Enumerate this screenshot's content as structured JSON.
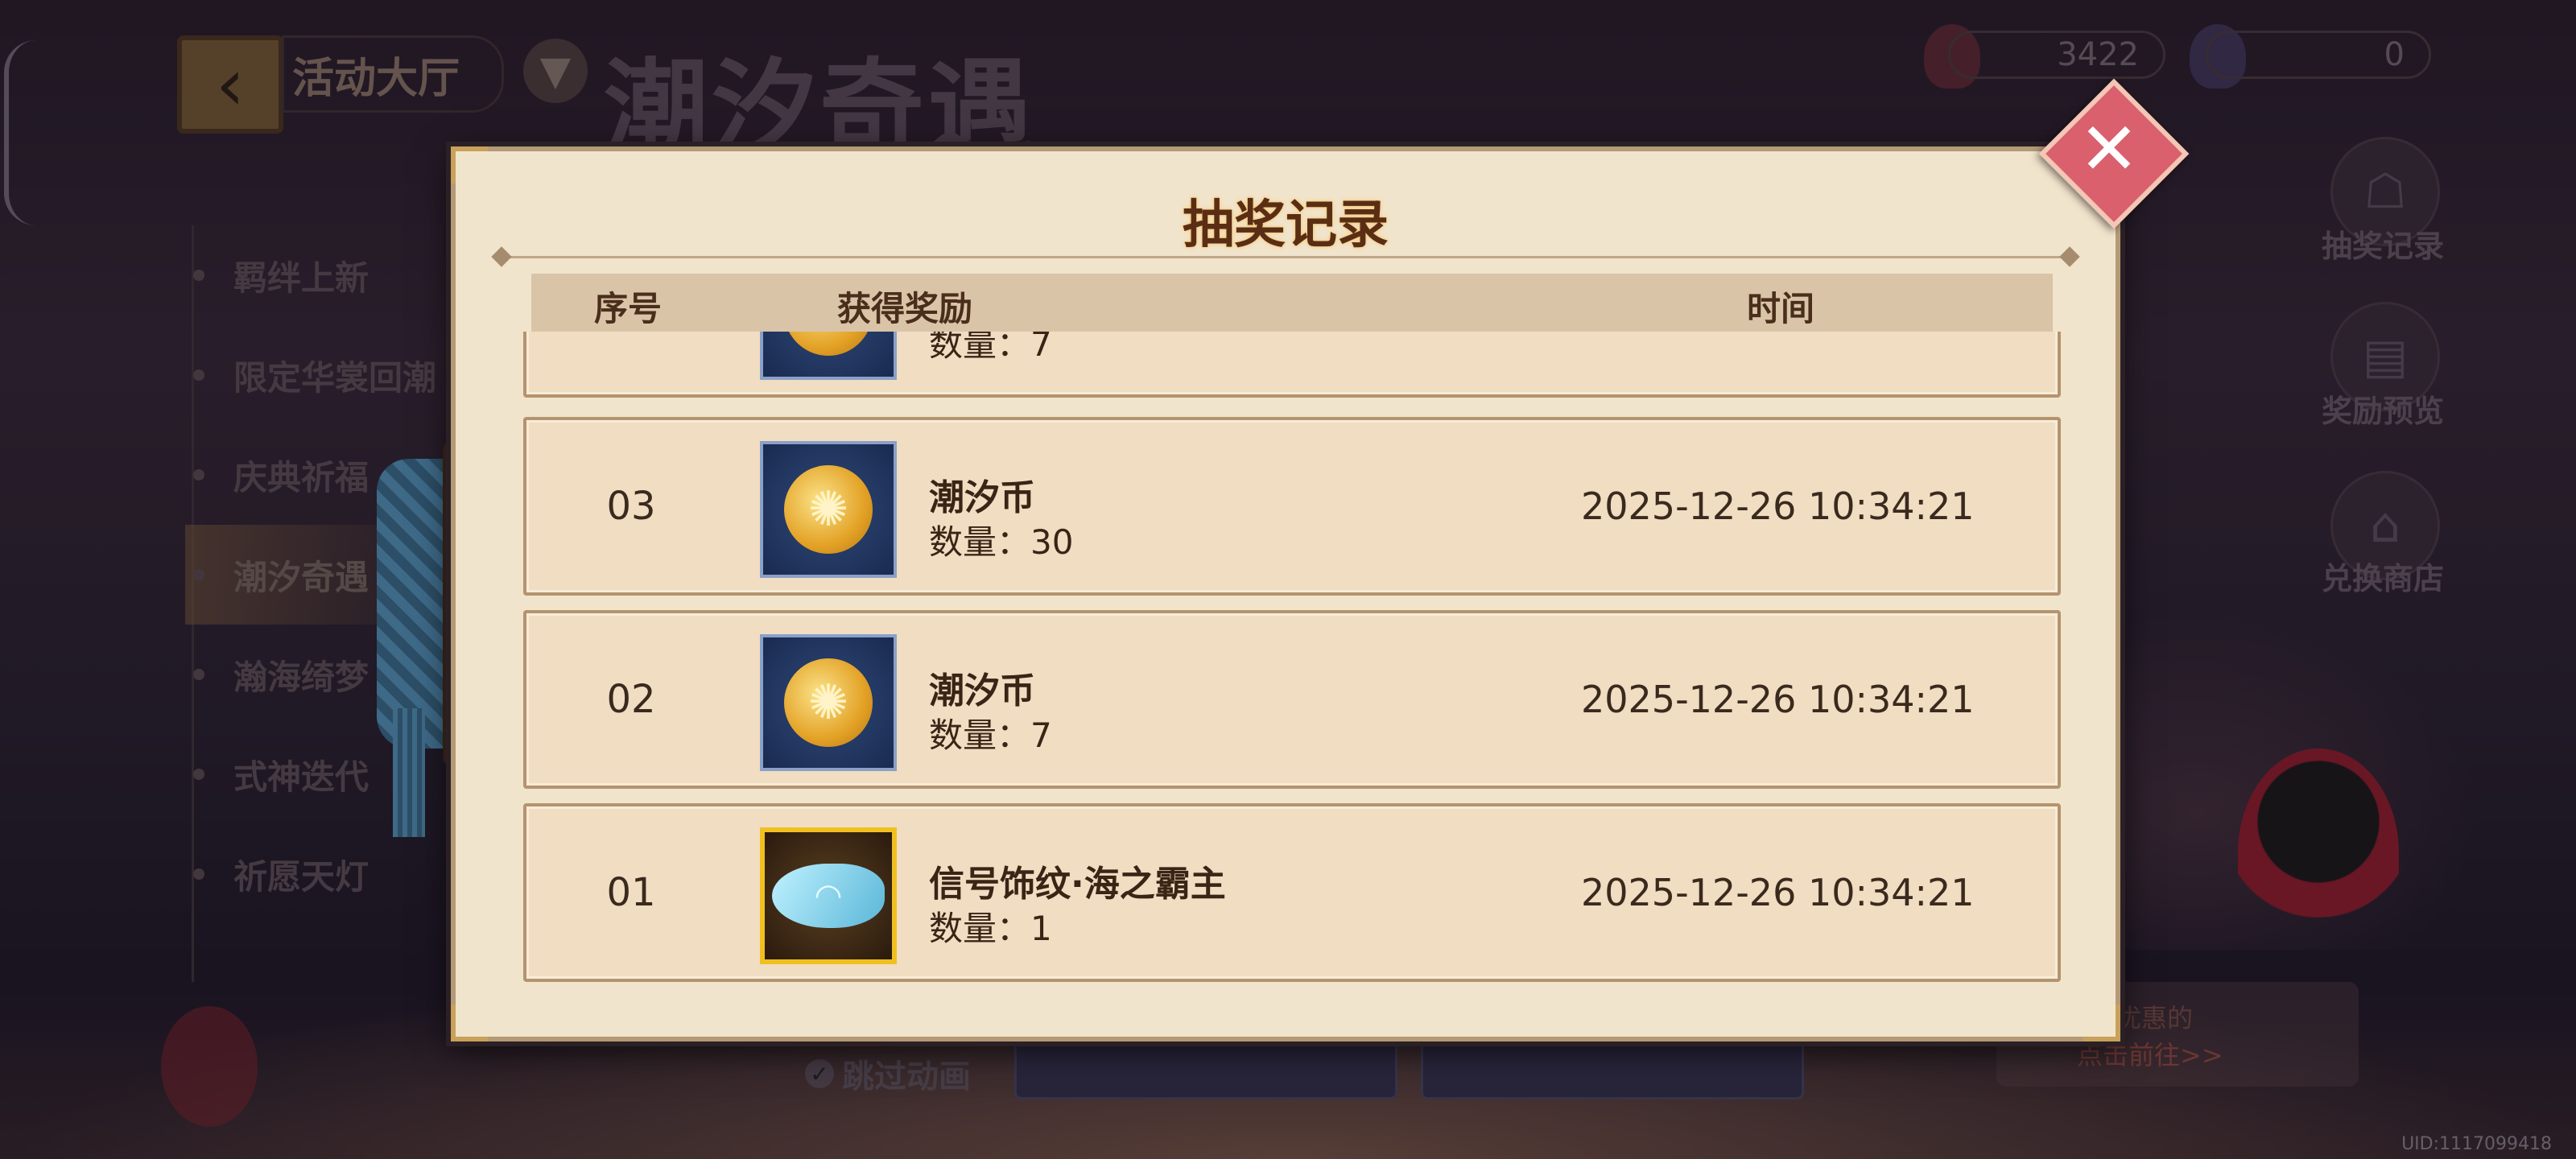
{
  "header": {
    "back_hall": "活动大厅",
    "title": "潮汐奇遇",
    "currency1": "3422",
    "currency2": "0"
  },
  "nav": {
    "items": [
      {
        "label": "羁绊上新"
      },
      {
        "label": "限定华裳回潮"
      },
      {
        "label": "庆典祈福"
      },
      {
        "label": "潮汐奇遇"
      },
      {
        "label": "瀚海绮梦"
      },
      {
        "label": "式神迭代"
      },
      {
        "label": "祈愿天灯"
      }
    ]
  },
  "side": {
    "draw_record": "抽奖记录",
    "reward_preview": "奖励预览",
    "exchange_shop": "兑换商店"
  },
  "bottom": {
    "skip_anim": "跳过动画",
    "promo_text": "可得更加优惠的",
    "promo_link": "点击前往>>",
    "uid": "UID:1117099418"
  },
  "modal": {
    "title": "抽奖记录",
    "col_seq": "序号",
    "col_reward": "获得奖励",
    "col_time": "时间",
    "partial_qty": "数量：7",
    "rows": [
      {
        "seq": "03",
        "name": "潮汐币",
        "qty": "数量：30",
        "time": "2025-12-26 10:34:21"
      },
      {
        "seq": "02",
        "name": "潮汐币",
        "qty": "数量：7",
        "time": "2025-12-26 10:34:21"
      },
      {
        "seq": "01",
        "name": "信号饰纹·海之霸主",
        "qty": "数量：1",
        "time": "2025-12-26 10:34:21"
      }
    ]
  },
  "colors": {
    "modal_bg": "#f1e4cc",
    "row_bg": "#f0ddc2",
    "close": "#d9606c",
    "title": "#5a2e14"
  }
}
